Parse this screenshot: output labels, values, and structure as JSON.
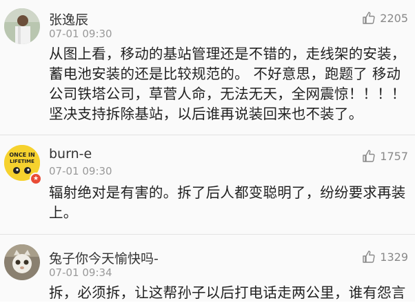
{
  "comments": [
    {
      "username": "张逸辰",
      "time": "07-01 09:30",
      "likes": "2205",
      "text_lines": [
        "从图上看，移动的基站管理还是不错的，走线架的安装，",
        "蓄电池安装的还是比较规范的。 不好意思，跑题了 移动",
        "公司铁塔公司，草菅人命，无法无天，全网震惊！！！！",
        "坚决支持拆除基站，以后谁再说装回来也不装了。"
      ],
      "avatar_icon": "person-photo-icon"
    },
    {
      "username": "burn-e",
      "time": "07-01 09:30",
      "likes": "1757",
      "text_lines": [
        "辐射绝对是有害的。拆了后人都变聪明了，纷纷要求再装",
        "上。"
      ],
      "avatar_icon": "once-in-lifetime-badge-icon",
      "avatar_text": [
        "ONCE IN",
        "LIFETIME"
      ]
    },
    {
      "username": "兔子你今天愉快吗-",
      "time": "07-01 09:34",
      "likes": "1329",
      "text_lines": [
        "拆，必须拆，让这帮孙子以后打电话走两公里，谁有怨言"
      ],
      "avatar_icon": "cat-photo-icon"
    }
  ],
  "colors": {
    "background": "#fafafa",
    "username": "#333333",
    "time": "#999999",
    "text": "#222222",
    "like": "#888888",
    "divider": "#e2e2e2"
  }
}
